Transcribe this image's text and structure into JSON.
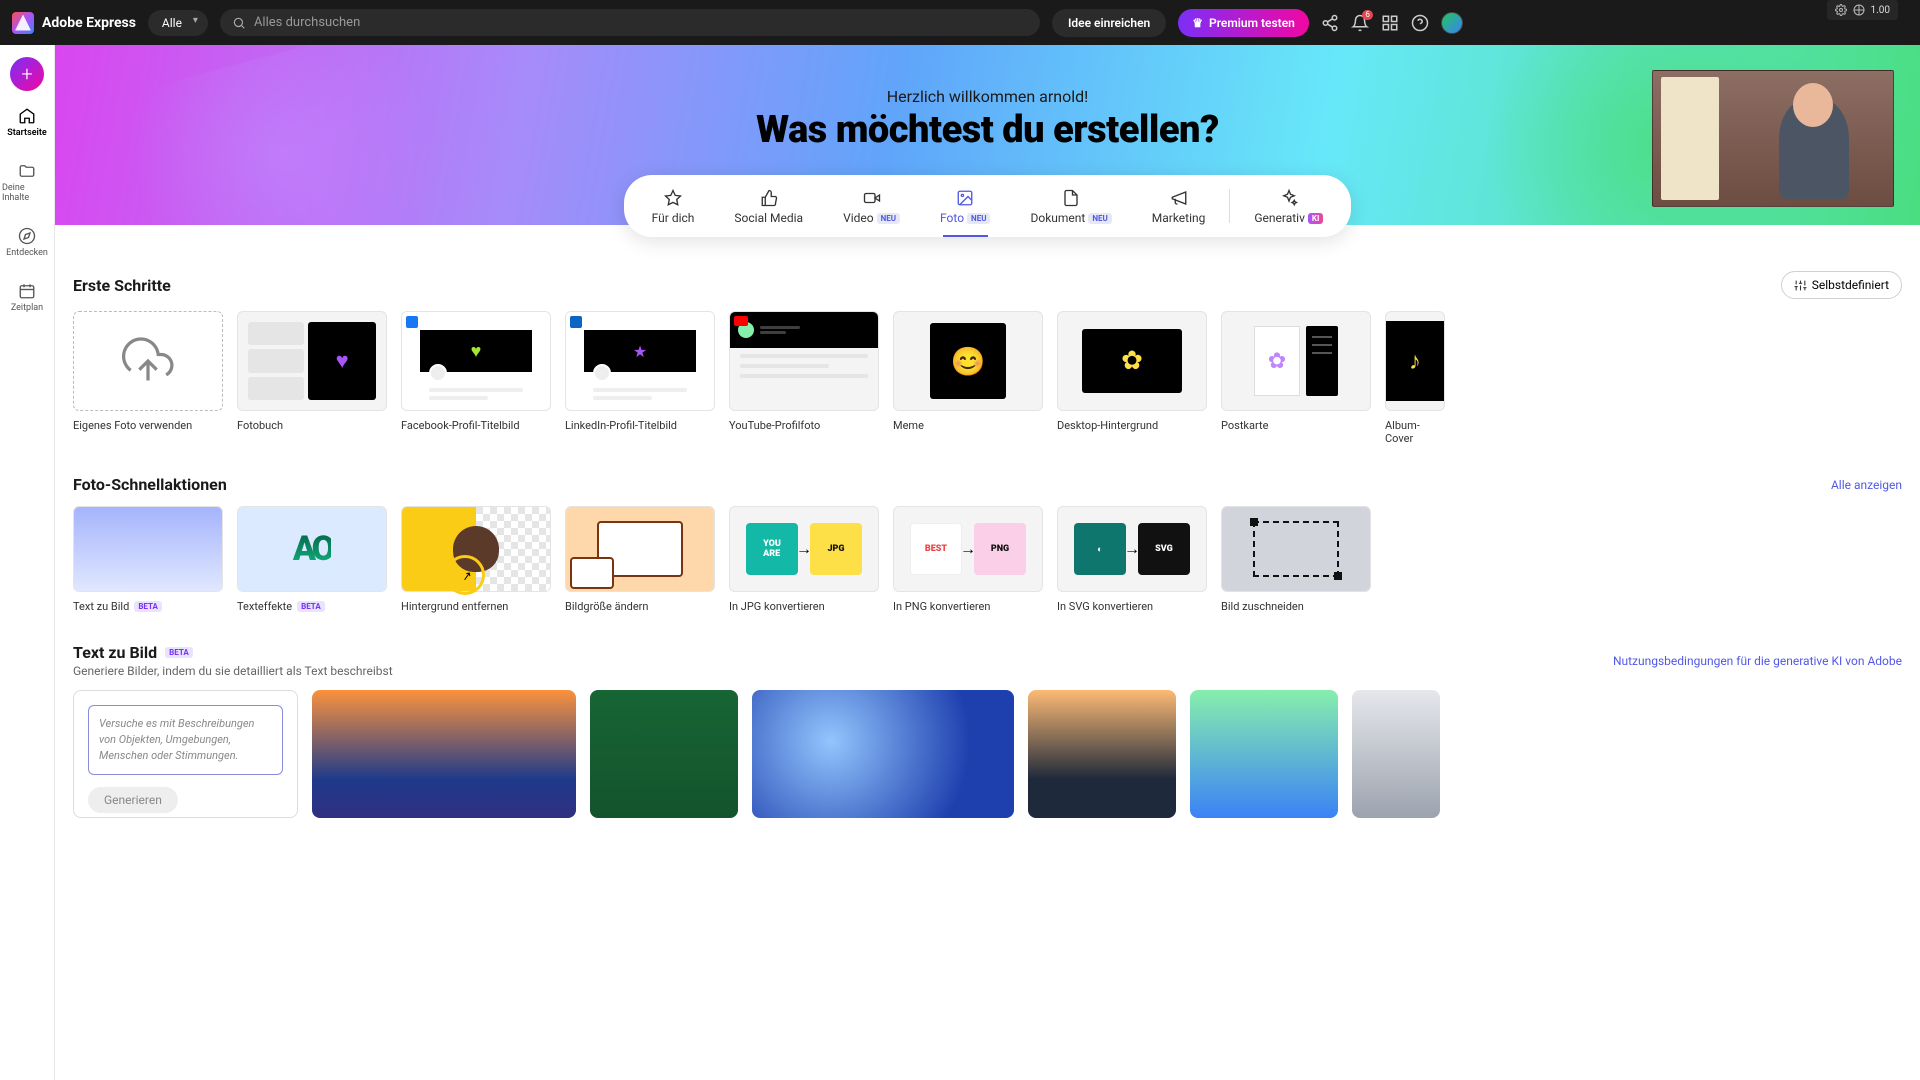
{
  "header": {
    "product_name": "Adobe Express",
    "category_selected": "Alle",
    "search_placeholder": "Alles durchsuchen",
    "btn_idea": "Idee einreichen",
    "btn_premium": "Premium testen",
    "notif_count": "6",
    "debug_value": "1.00"
  },
  "sidebar": {
    "items": [
      {
        "key": "home",
        "label": "Startseite"
      },
      {
        "key": "content",
        "label": "Deine Inhalte"
      },
      {
        "key": "discover",
        "label": "Entdecken"
      },
      {
        "key": "schedule",
        "label": "Zeitplan"
      }
    ]
  },
  "hero": {
    "welcome": "Herzlich willkommen arnold!",
    "headline": "Was möchtest du erstellen?"
  },
  "tabs": [
    {
      "key": "foryou",
      "label": "Für dich",
      "badge": ""
    },
    {
      "key": "social",
      "label": "Social Media",
      "badge": ""
    },
    {
      "key": "video",
      "label": "Video",
      "badge": "NEU"
    },
    {
      "key": "foto",
      "label": "Foto",
      "badge": "NEU",
      "active": true
    },
    {
      "key": "doc",
      "label": "Dokument",
      "badge": "NEU"
    },
    {
      "key": "marketing",
      "label": "Marketing",
      "badge": ""
    },
    {
      "key": "gen",
      "label": "Generativ",
      "badge": "KI"
    }
  ],
  "section_first": {
    "title": "Erste Schritte",
    "custom_btn": "Selbstdefiniert",
    "cards": [
      {
        "label": "Eigenes Foto verwenden"
      },
      {
        "label": "Fotobuch"
      },
      {
        "label": "Facebook-Profil-Titelbild"
      },
      {
        "label": "LinkedIn-Profil-Titelbild"
      },
      {
        "label": "YouTube-Profilfoto"
      },
      {
        "label": "Meme"
      },
      {
        "label": "Desktop-Hintergrund"
      },
      {
        "label": "Postkarte"
      },
      {
        "label": "Album-Cover"
      }
    ]
  },
  "section_qa": {
    "title": "Foto-Schnellaktionen",
    "show_all": "Alle anzeigen",
    "cards": [
      {
        "label": "Text zu Bild",
        "badge": "BETA"
      },
      {
        "label": "Texteffekte",
        "badge": "BETA"
      },
      {
        "label": "Hintergrund entfernen"
      },
      {
        "label": "Bildgröße ändern"
      },
      {
        "label": "In JPG konvertieren",
        "fmt": "JPG"
      },
      {
        "label": "In PNG konvertieren",
        "fmt": "PNG"
      },
      {
        "label": "In SVG konvertieren",
        "fmt": "SVG"
      },
      {
        "label": "Bild zuschneiden"
      }
    ]
  },
  "section_t2i": {
    "title": "Text zu Bild",
    "badge": "BETA",
    "subtitle": "Generiere Bilder, indem du sie detailliert als Text beschreibst",
    "terms_link": "Nutzungsbedingungen für die generative KI von Adobe",
    "prompt_placeholder": "Versuche es mit Beschreibungen von Objekten, Umgebungen, Menschen oder Stimmungen.",
    "generate_btn": "Generieren"
  }
}
